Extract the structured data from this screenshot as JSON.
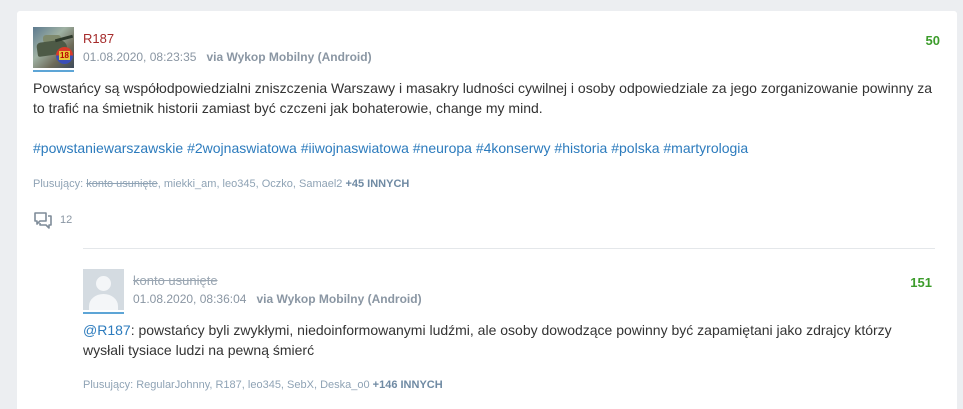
{
  "post": {
    "username": "R187",
    "username_color": "#a52a2a",
    "timestamp": "01.08.2020, 08:23:35",
    "via": "via Wykop Mobilny (Android)",
    "votes": "50",
    "text": "Powstańcy są współodpowiedzialni zniszczenia Warszawy i masakry ludności cywilnej i osoby odpowiedziale za jego zorganizowanie powinny za to trafić na śmietnik historii zamiast być czczeni jak bohaterowie, change my mind.",
    "tags": [
      "#powstaniewarszawskie",
      "#2wojnaswiatowa",
      "#iiwojnaswiatowa",
      "#neuropa",
      "#4konserwy",
      "#historia",
      "#polska",
      "#martyrologia"
    ],
    "voters_label": "Plusujący:",
    "voters_deleted": "konto usunięte",
    "voters_rest": ", miekki_am, leo345, Oczko, Samael2",
    "voters_more": "+45 INNYCH",
    "comments_count": "12"
  },
  "reply": {
    "username": "konto usunięte",
    "timestamp": "01.08.2020, 08:36:04",
    "via": "via Wykop Mobilny (Android)",
    "votes": "151",
    "mention": "@R187",
    "text": ": powstańcy byli zwykłymi, niedoinformowanymi ludźmi, ale osoby dowodzące powinny być zapamiętani jako zdrajcy którzy wysłali tysiace ludzi na pewną śmierć",
    "voters_label": "Plusujący:",
    "voters_list": "RegularJohnny, R187, leo345, SebX, Deska_o0",
    "voters_more": "+146 INNYCH"
  },
  "colors": {
    "accent": "#2c7bbd",
    "votes": "#3c9c2b",
    "meta": "#8a96a3"
  }
}
